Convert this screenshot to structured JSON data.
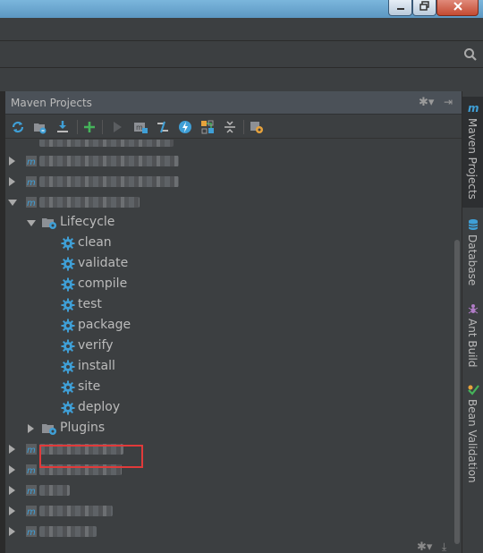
{
  "panel": {
    "title": "Maven Projects",
    "gear_symbol": "✱▾",
    "hide_symbol": "⇥"
  },
  "toolbar": {
    "buttons": [
      {
        "icon": "refresh-icon"
      },
      {
        "icon": "generate-sources-icon"
      },
      {
        "icon": "download-sources-icon"
      },
      {
        "icon": "add-maven-project-icon"
      },
      {
        "icon": "run-maven-build-icon"
      },
      {
        "icon": "execute-goal-icon"
      },
      {
        "icon": "toggle-offline-icon"
      },
      {
        "icon": "skip-tests-icon"
      },
      {
        "icon": "show-dependencies-icon"
      },
      {
        "icon": "collapse-all-icon"
      },
      {
        "icon": "maven-settings-icon"
      }
    ]
  },
  "tree": {
    "lifecycle_label": "Lifecycle",
    "plugins_label": "Plugins",
    "goals": [
      "clean",
      "validate",
      "compile",
      "test",
      "package",
      "verify",
      "install",
      "site",
      "deploy"
    ],
    "highlighted_goal": "deploy"
  },
  "side_tabs": [
    {
      "label": "Maven Projects",
      "icon": "maven-icon",
      "active": true
    },
    {
      "label": "Database",
      "icon": "database-icon",
      "active": false
    },
    {
      "label": "Ant Build",
      "icon": "ant-icon",
      "active": false
    },
    {
      "label": "Bean Validation",
      "icon": "bean-validation-icon",
      "active": false
    }
  ],
  "colors": {
    "background": "#3c3f41",
    "header": "#4b5158",
    "highlight_border": "#e13a3a",
    "gear_blue": "#3f9fd6"
  }
}
